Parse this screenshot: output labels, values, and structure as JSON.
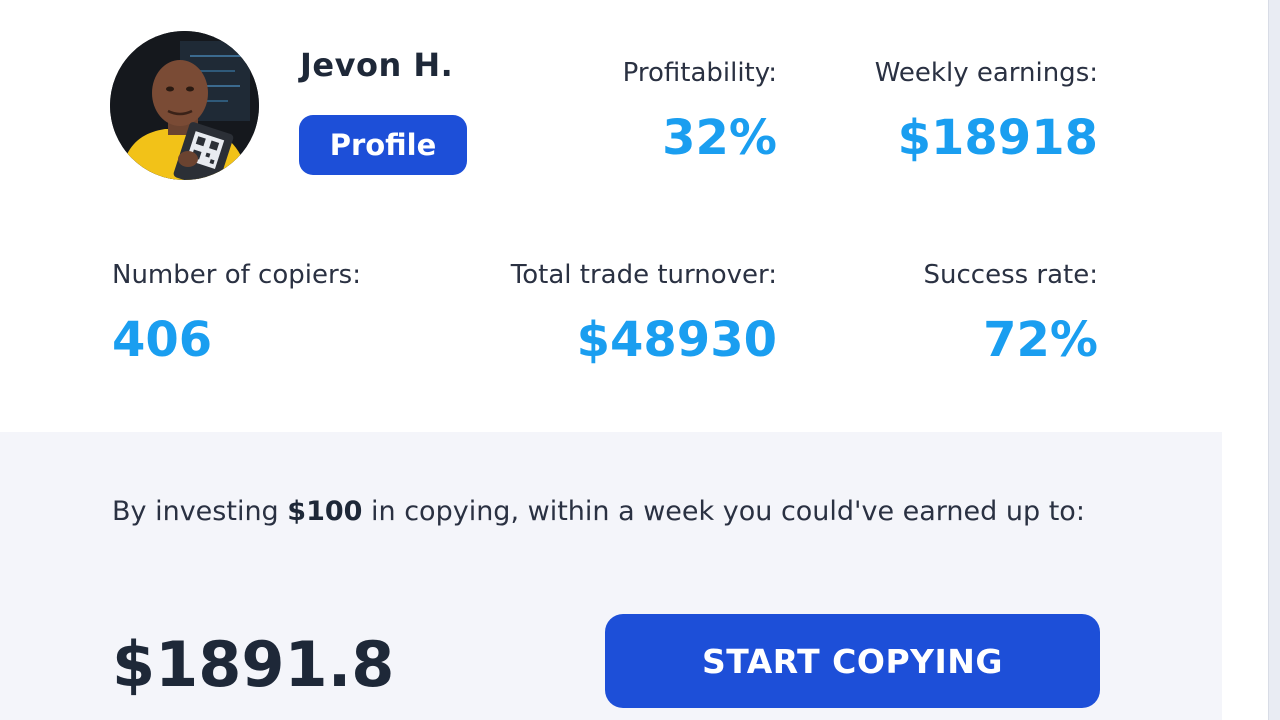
{
  "trader": {
    "name": "Jevon H.",
    "profile_label": "Profile"
  },
  "stats": {
    "profitability_label": "Profitability:",
    "profitability_value": "32%",
    "weekly_earnings_label": "Weekly earnings:",
    "weekly_earnings_value": "$18918",
    "copiers_label": "Number of copiers:",
    "copiers_value": "406",
    "turnover_label": "Total trade turnover:",
    "turnover_value": "$48930",
    "success_label": "Success rate:",
    "success_value": "72%"
  },
  "invest": {
    "text_prefix": "By investing ",
    "amount": "$100",
    "text_suffix": " in copying, within a week you could've earned up to:",
    "earned_value": "$1891.8",
    "start_label": "START COPYING"
  },
  "colors": {
    "accent_blue": "#1d4fd8",
    "value_blue": "#1a9ef0",
    "dark_text": "#1e2838",
    "panel_bg": "#f4f5fa"
  }
}
